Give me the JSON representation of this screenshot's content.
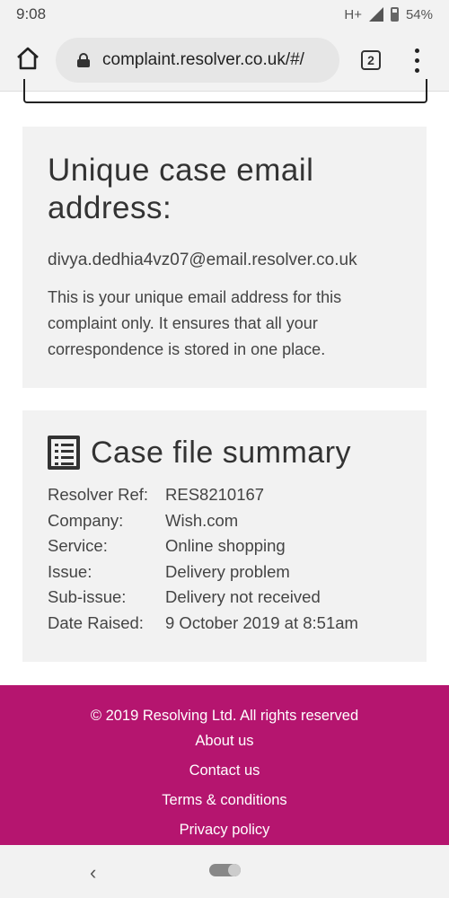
{
  "status_bar": {
    "time": "9:08",
    "network": "H+",
    "battery": "54%"
  },
  "browser": {
    "url": "complaint.resolver.co.uk/#/",
    "tab_count": "2"
  },
  "email_card": {
    "heading": "Unique case email address:",
    "email": "divya.dedhia4vz07@email.resolver.co.uk",
    "description": "This is your unique email address for this complaint only. It ensures that all your correspondence is stored in one place."
  },
  "summary_card": {
    "title": "Case file summary",
    "rows": [
      {
        "label": "Resolver Ref:",
        "value": "RES8210167"
      },
      {
        "label": "Company:",
        "value": "Wish.com"
      },
      {
        "label": "Service:",
        "value": "Online shopping"
      },
      {
        "label": "Issue:",
        "value": "Delivery problem"
      },
      {
        "label": "Sub-issue:",
        "value": "Delivery not received"
      },
      {
        "label": "Date Raised:",
        "value": "9 October 2019 at 8:51am"
      }
    ]
  },
  "footer": {
    "copyright": "© 2019 Resolving Ltd. All rights reserved",
    "about": "About us",
    "contact": "Contact us",
    "terms": "Terms & conditions",
    "privacy": "Privacy policy"
  },
  "nav": {
    "back": "‹"
  },
  "colors": {
    "footer_bg": "#b5156f",
    "card_bg": "#f2f2f2"
  },
  "icons": [
    "home-icon",
    "lock-icon",
    "menu-icon",
    "case-file-icon",
    "back-icon"
  ]
}
